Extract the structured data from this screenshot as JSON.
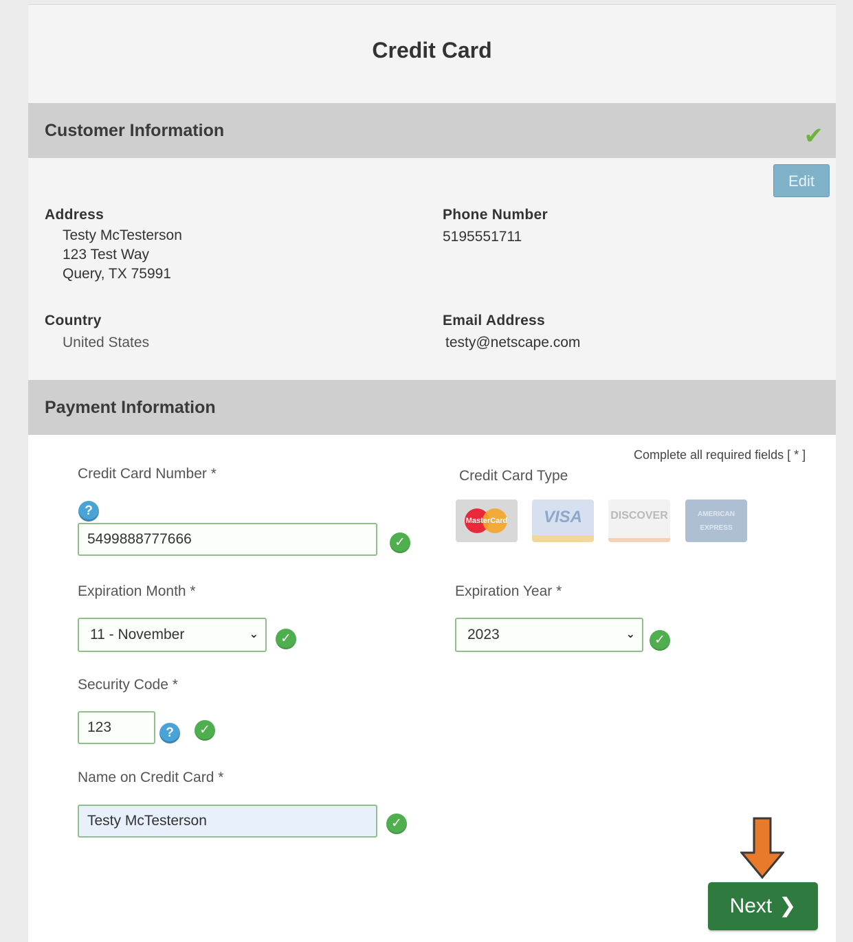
{
  "page": {
    "title": "Credit Card"
  },
  "customer": {
    "header": "Customer Information",
    "status_icon": "checkmark-icon",
    "edit_label": "Edit",
    "address_label": "Address",
    "address_lines": [
      "Testy McTesterson",
      "123 Test Way",
      "Query, TX 75991"
    ],
    "phone_label": "Phone Number",
    "phone_value": "5195551711",
    "country_label": "Country",
    "country_value": "United States",
    "email_label": "Email Address",
    "email_value": "testy@netscape.com"
  },
  "payment": {
    "header": "Payment Information",
    "required_note": "Complete all required fields [ * ]",
    "card_number_label": "Credit Card Number *",
    "card_number_value": "5499888777666",
    "card_type_label": "Credit Card Type",
    "card_types": [
      "MasterCard",
      "VISA",
      "DISCOVER",
      "AMERICAN EXPRESS"
    ],
    "exp_month_label": "Expiration Month *",
    "exp_month_value": "11 - November",
    "exp_year_label": "Expiration Year *",
    "exp_year_value": "2023",
    "security_code_label": "Security Code *",
    "security_code_value": "123",
    "name_label": "Name on Credit Card *",
    "name_value": "Testy McTesterson",
    "next_label": "Next"
  },
  "colors": {
    "header_bg": "#cfcfcf",
    "next_button": "#2f7a3f",
    "valid_green": "#4fae4e",
    "help_blue": "#4aa3d6",
    "annotation_arrow": "#e87a2c"
  }
}
